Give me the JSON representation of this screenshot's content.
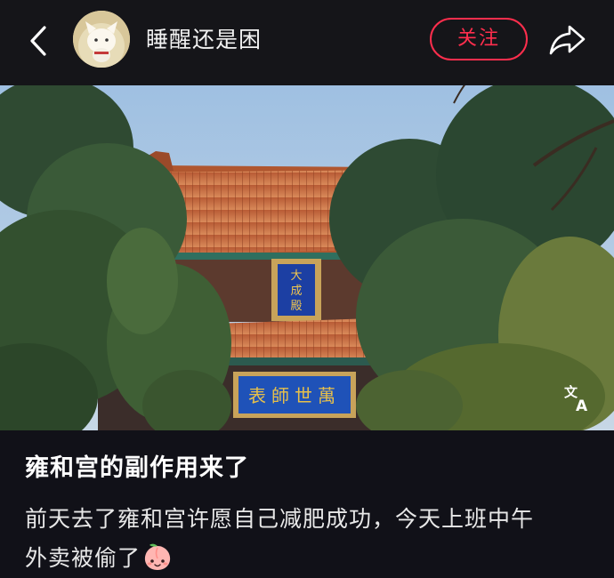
{
  "header": {
    "username": "睡醒还是困",
    "follow_label": "关注"
  },
  "post": {
    "title": "雍和宫的副作用来了",
    "body_line_1": "前天去了雍和宫许愿自己减肥成功，今天上班中午",
    "body_line_2": "外卖被偷了"
  },
  "photo": {
    "plaque_upper": "大成殿",
    "plaque_lower": "萬世師表"
  },
  "icons": {
    "back": "chevron-left-icon",
    "share": "share-arrow-icon",
    "translate": "translate-icon",
    "emoji": "peach-face-emoji"
  },
  "colors": {
    "accent": "#ff2e4d",
    "background": "#111118"
  }
}
